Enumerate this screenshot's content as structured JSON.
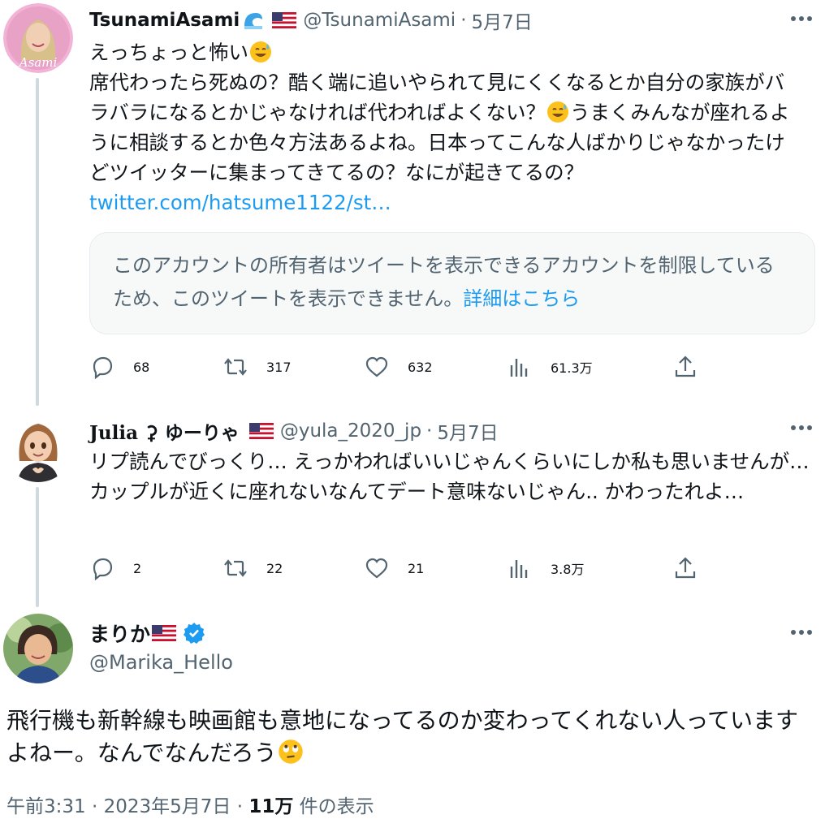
{
  "tweet1": {
    "name": "TsunamiAsami",
    "handle": "@TsunamiAsami",
    "separator": "·",
    "date": "5月7日",
    "avatar_text": "Asami",
    "line1": "えっちょっと怖い",
    "body": "席代わったら死ぬの？酷く端に追いやられて見にくくなるとか自分の家族がバラバラになるとかじゃなければ代わればよくない？",
    "body2": "うまくみんなが座れるように相談するとか色々方法あるよね。日本ってこんな人ばかりじゃなかったけどツイッターに集まってきてるの？なにが起きてるの？",
    "link": "twitter.com/hatsume1122/st…",
    "quote_text": "このアカウントの所有者はツイートを表示できるアカウントを制限しているため、このツイートを表示できません。",
    "quote_link": "詳細はこちら",
    "replies": "68",
    "retweets": "317",
    "likes": "632",
    "views": "61.3万"
  },
  "tweet2": {
    "name": "Julia ⚳ ゆーりゃ",
    "handle": "@yula_2020_jp",
    "separator": "·",
    "date": "5月7日",
    "body": "リプ読んでびっくり… えっかわればいいじゃんくらいにしか私も思いませんが… カップルが近くに座れないなんてデート意味ないじゃん.. かわったれよ…",
    "replies": "2",
    "retweets": "22",
    "likes": "21",
    "views": "3.8万"
  },
  "tweet3": {
    "name": "まりか",
    "handle": "@Marika_Hello",
    "body": "飛行機も新幹線も映画館も意地になってるのか変わってくれない人っていますよねー。なんでなんだろう",
    "time": "午前3:31 · 2023年5月7日 · ",
    "views_count": "11万",
    "views_label": " 件の表示"
  },
  "colors": {
    "accent": "#1d9bf0",
    "muted": "#536471",
    "text": "#0f1419",
    "thread_line": "#cfd9de"
  },
  "icons": [
    "more-icon",
    "reply-icon",
    "retweet-icon",
    "like-icon",
    "views-icon",
    "share-icon",
    "verified-icon",
    "us-flag-icon",
    "wave-icon",
    "sweat-smile-icon",
    "eye-roll-icon"
  ]
}
